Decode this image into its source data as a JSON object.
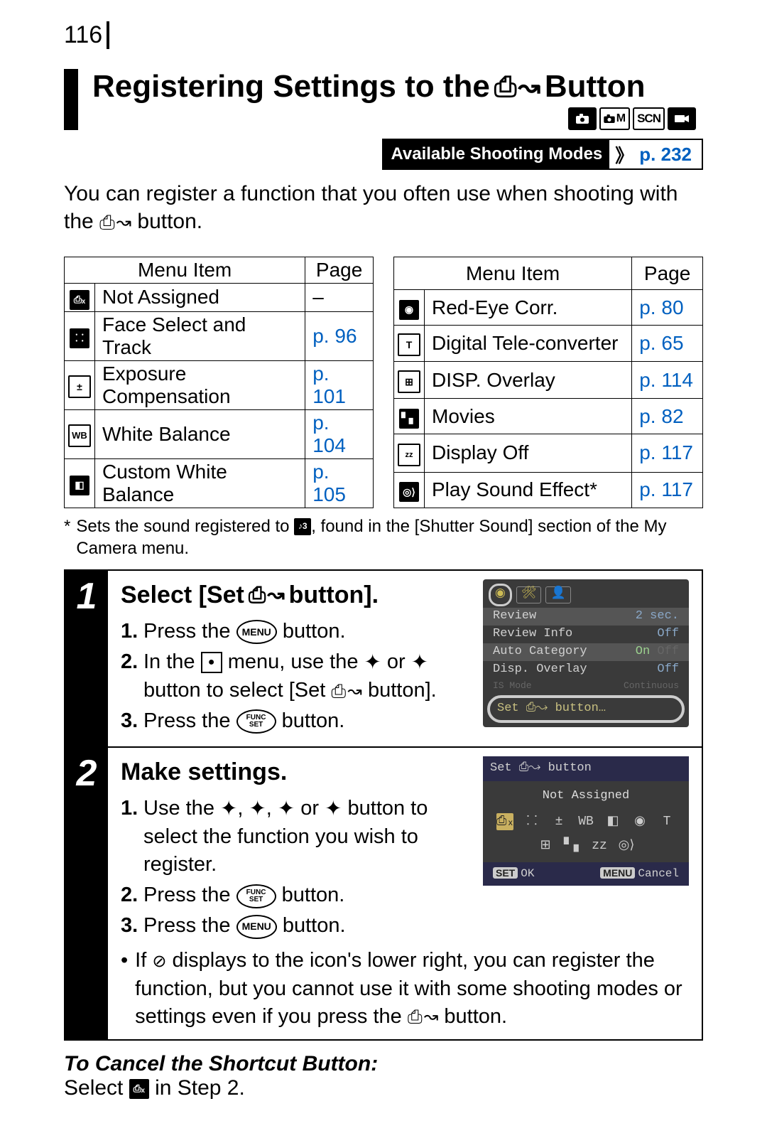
{
  "page_number": "116",
  "title_pre": "Registering Settings to the",
  "title_post": "Button",
  "mode_badges": [
    "●",
    "□M",
    "SCN",
    "▘▖"
  ],
  "available_modes_label": "Available Shooting Modes",
  "available_modes_page": "p. 232",
  "intro_pre": "You can register a function that you often use when shooting with the",
  "intro_post": "button.",
  "table_headers": {
    "item": "Menu Item",
    "page": "Page"
  },
  "table_left": [
    {
      "name": "Not Assigned",
      "page": "–",
      "link": false
    },
    {
      "name": "Face Select and Track",
      "page": "p. 96",
      "link": true
    },
    {
      "name": "Exposure Compensation",
      "page": "p. 101",
      "link": true
    },
    {
      "name": "White Balance",
      "page": "p. 104",
      "link": true
    },
    {
      "name": "Custom White Balance",
      "page": "p. 105",
      "link": true
    }
  ],
  "table_right": [
    {
      "name": "Red-Eye Corr.",
      "page": "p. 80",
      "link": true
    },
    {
      "name": "Digital Tele-converter",
      "page": "p. 65",
      "link": true
    },
    {
      "name": "DISP. Overlay",
      "page": "p. 114",
      "link": true
    },
    {
      "name": "Movies",
      "page": "p. 82",
      "link": true
    },
    {
      "name": "Display Off",
      "page": "p. 117",
      "link": true
    },
    {
      "name": "Play Sound Effect*",
      "page": "p. 117",
      "link": true
    }
  ],
  "footnote_mark": "*",
  "footnote_pre": "Sets the sound registered to",
  "footnote_post": ", found in the [Shutter Sound] section of the My Camera menu.",
  "step1": {
    "num": "1",
    "title_pre": "Select [Set",
    "title_post": "button].",
    "sub1_num": "1.",
    "sub1_pre": "Press the",
    "sub1_post": "button.",
    "menu_label": "MENU",
    "sub2_num": "2.",
    "sub2_pre": "In the",
    "sub2_mid1": "menu, use the",
    "sub2_mid2": "or",
    "sub2_mid3": "button to select [Set",
    "sub2_post": "button].",
    "sub3_num": "3.",
    "sub3_pre": "Press the",
    "func_label_top": "FUNC",
    "func_label_bot": "SET",
    "sub3_post": "button.",
    "lcd": {
      "rows": [
        {
          "label": "Review",
          "value": "2 sec."
        },
        {
          "label": "Review Info",
          "value": "Off"
        },
        {
          "label": "Auto Category",
          "value": "On",
          "dim": "Off"
        },
        {
          "label": "Disp. Overlay",
          "value": "Off"
        },
        {
          "label": "IS Mode",
          "value": "Continuous"
        }
      ],
      "selected": "Set ⎙↝ button…"
    }
  },
  "step2": {
    "num": "2",
    "title": "Make settings.",
    "sub1_num": "1.",
    "sub1_pre": "Use the",
    "sub1_c1": ",",
    "sub1_c2": ",",
    "sub1_or": "or",
    "sub1_post": "button to select the function you wish to register.",
    "sub2_num": "2.",
    "sub2_pre": "Press the",
    "sub2_post": "button.",
    "sub3_num": "3.",
    "sub3_pre": "Press the",
    "sub3_post": "button.",
    "note_bullet": "•",
    "note_pre": "If",
    "note_mid": "displays to the icon's lower right, you can register the function, but you cannot use it with some shooting modes or settings even if you press the",
    "note_post": "button.",
    "lcd": {
      "header": "Set ⎙↝ button",
      "center": "Not Assigned",
      "ok": "OK",
      "cancel": "Cancel",
      "set": "SET",
      "menu": "MENU"
    }
  },
  "cancel_heading": "To Cancel the Shortcut Button:",
  "cancel_pre": "Select",
  "cancel_post": "in Step 2."
}
